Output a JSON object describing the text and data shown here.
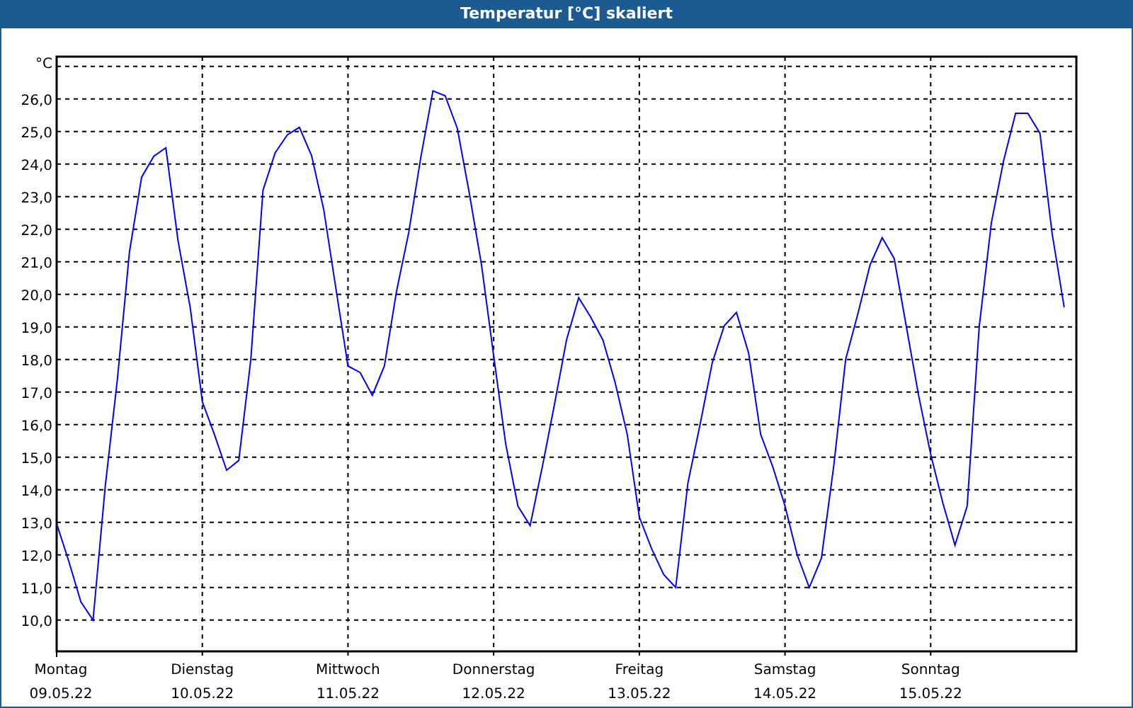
{
  "window": {
    "title": "Temperatur [°C] skaliert"
  },
  "chart": {
    "chart_data": {
      "type": "line",
      "grid": true,
      "ylabel": "°C",
      "ylim": [
        9.04,
        27.3
      ],
      "categories": [
        "Montag\n09.05.22",
        null,
        null,
        null,
        null,
        null,
        null,
        null,
        null,
        null,
        null,
        null,
        "Dienstag\n10.05.22",
        null,
        null,
        null,
        null,
        null,
        null,
        null,
        null,
        null,
        null,
        null,
        "Mittwoch\n11.05.22",
        null,
        null,
        null,
        null,
        null,
        null,
        null,
        null,
        null,
        null,
        null,
        "Donnerstag\n12.05.22",
        null,
        null,
        null,
        null,
        null,
        null,
        null,
        null,
        null,
        null,
        null,
        "Freitag\n13.05.22",
        null,
        null,
        null,
        null,
        null,
        null,
        null,
        null,
        null,
        null,
        null,
        "Samstag\n14.05.22",
        null,
        null,
        null,
        null,
        null,
        null,
        null,
        null,
        null,
        null,
        null,
        "Sonntag\n15.05.22",
        null,
        null,
        null,
        null,
        null,
        null,
        null,
        null,
        null,
        null,
        null
      ],
      "yticks": [
        {
          "value": 10,
          "label": "10,0"
        },
        {
          "value": 11,
          "label": "11,0"
        },
        {
          "value": 12,
          "label": "12,0"
        },
        {
          "value": 13,
          "label": "13,0"
        },
        {
          "value": 14,
          "label": "14,0"
        },
        {
          "value": 15,
          "label": "15,0"
        },
        {
          "value": 16,
          "label": "16,0"
        },
        {
          "value": 17,
          "label": "17,0"
        },
        {
          "value": 18,
          "label": "18,0"
        },
        {
          "value": 19,
          "label": "19,0"
        },
        {
          "value": 20,
          "label": "20,0"
        },
        {
          "value": 21,
          "label": "21,0"
        },
        {
          "value": 22,
          "label": "22,0"
        },
        {
          "value": 23,
          "label": "23,0"
        },
        {
          "value": 24,
          "label": "24,0"
        },
        {
          "value": 25,
          "label": "25,0"
        },
        {
          "value": 26,
          "label": "26,0"
        }
      ],
      "series": [
        {
          "color": "#0000ff",
          "values": [
            12.96,
            11.8,
            10.56,
            10.0,
            14.1,
            17.4,
            21.3,
            23.6,
            24.24,
            24.5,
            21.65,
            19.6,
            16.7,
            15.7,
            14.6,
            14.9,
            18.0,
            23.2,
            24.35,
            24.9,
            25.13,
            24.26,
            22.6,
            20.2,
            17.8,
            17.6,
            16.9,
            17.8,
            20.1,
            21.9,
            24.2,
            26.25,
            26.1,
            25.1,
            23.1,
            20.9,
            18.1,
            15.4,
            13.5,
            12.9,
            14.7,
            16.6,
            18.6,
            19.9,
            19.3,
            18.6,
            17.3,
            15.7,
            13.17,
            12.2,
            11.4,
            11.0,
            14.2,
            16.0,
            17.9,
            19.04,
            19.45,
            18.2,
            15.7,
            14.7,
            13.5,
            12.0,
            11.0,
            11.9,
            14.7,
            18.0,
            19.4,
            20.9,
            21.74,
            21.1,
            19.0,
            16.9,
            15.1,
            13.6,
            12.3,
            13.5,
            19.0,
            22.2,
            24.1,
            25.56,
            25.56,
            24.95,
            21.87,
            19.6
          ]
        }
      ]
    }
  }
}
